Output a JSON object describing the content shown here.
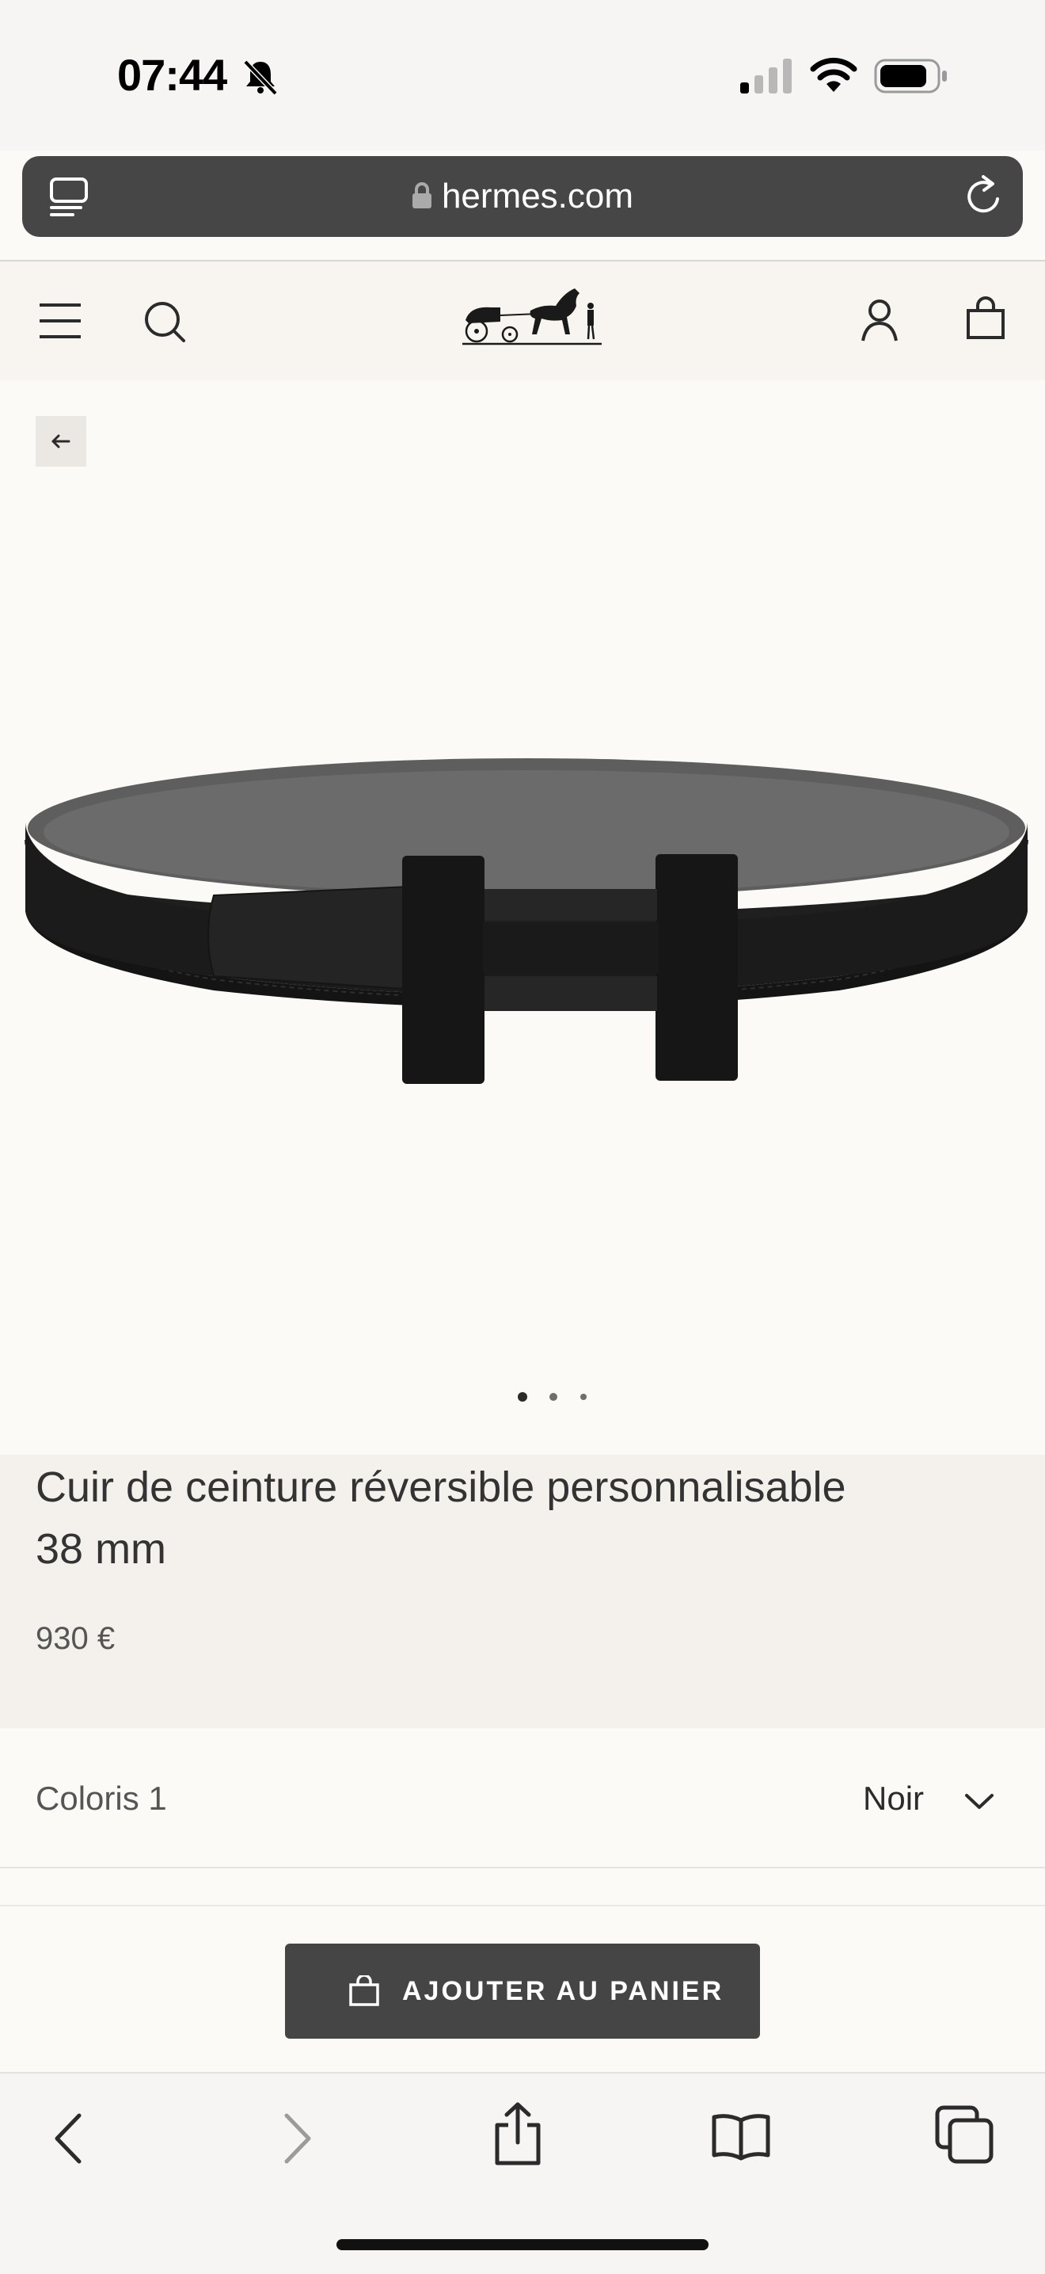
{
  "status_bar": {
    "time": "07:44"
  },
  "browser": {
    "url": "hermes.com"
  },
  "header": {
    "logo_alt": "Hermès carriage logo"
  },
  "product": {
    "title_line1": "Cuir de ceinture réversible personnalisable",
    "title_line2": "38 mm",
    "price": "930 €",
    "gallery_dots": 3,
    "gallery_active": 1
  },
  "options": {
    "coloris_label": "Coloris 1",
    "coloris_value": "Noir"
  },
  "cta": {
    "add_to_cart": "AJOUTER AU PANIER"
  },
  "colors": {
    "ink": "#2b2b2b",
    "cta_bg": "#454545",
    "info_bg": "#f4f0eb",
    "page_bg": "#fcfaf6"
  },
  "icons": [
    "bell-slash-icon",
    "signal-icon",
    "wifi-icon",
    "battery-icon",
    "tabs-reader-icon",
    "lock-icon",
    "reload-icon",
    "menu-icon",
    "search-icon",
    "account-icon",
    "bag-icon",
    "arrow-left-icon",
    "chevron-down-icon",
    "nav-back-icon",
    "nav-forward-icon",
    "share-icon",
    "bookmarks-icon",
    "tabs-icon"
  ]
}
